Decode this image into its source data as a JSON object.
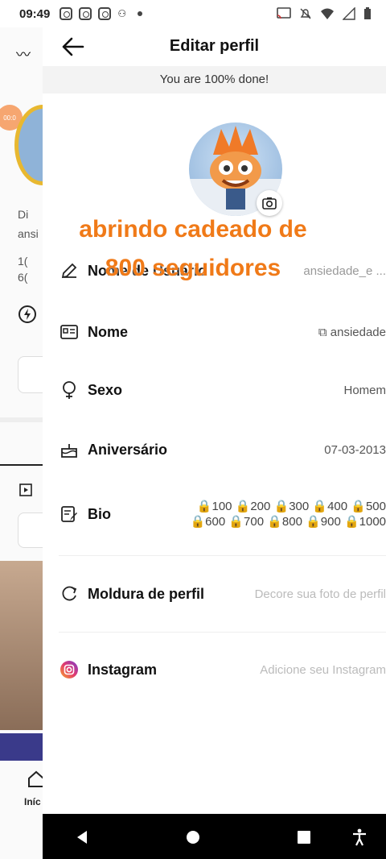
{
  "status_bar": {
    "time": "09:49"
  },
  "background": {
    "home_label": "Iníc",
    "text1": "Di",
    "text2": "ansi",
    "text3": "1(",
    "text4": "6(",
    "badge": "00:0"
  },
  "header": {
    "title": "Editar perfil"
  },
  "progress": {
    "text": "You are 100% done!"
  },
  "overlay": {
    "line1": "abrindo cadeado de",
    "line2": "800 seguidores"
  },
  "rows": {
    "username": {
      "label": "Nome de Usuário",
      "value": "ansiedade_e ..."
    },
    "name": {
      "label": "Nome",
      "value": "ansiedade"
    },
    "gender": {
      "label": "Sexo",
      "value": "Homem"
    },
    "birthday": {
      "label": "Aniversário",
      "value": "07-03-2013"
    },
    "bio": {
      "label": "Bio",
      "line1": "🔒100 🔒200 🔒300 🔒400 🔒500",
      "line2": "🔒600 🔒700 🔒800 🔒900 🔒1000"
    },
    "frame": {
      "label": "Moldura de perfil",
      "value": "Decore sua foto de perfil"
    },
    "instagram": {
      "label": "Instagram",
      "value": "Adicione seu Instagram"
    }
  }
}
